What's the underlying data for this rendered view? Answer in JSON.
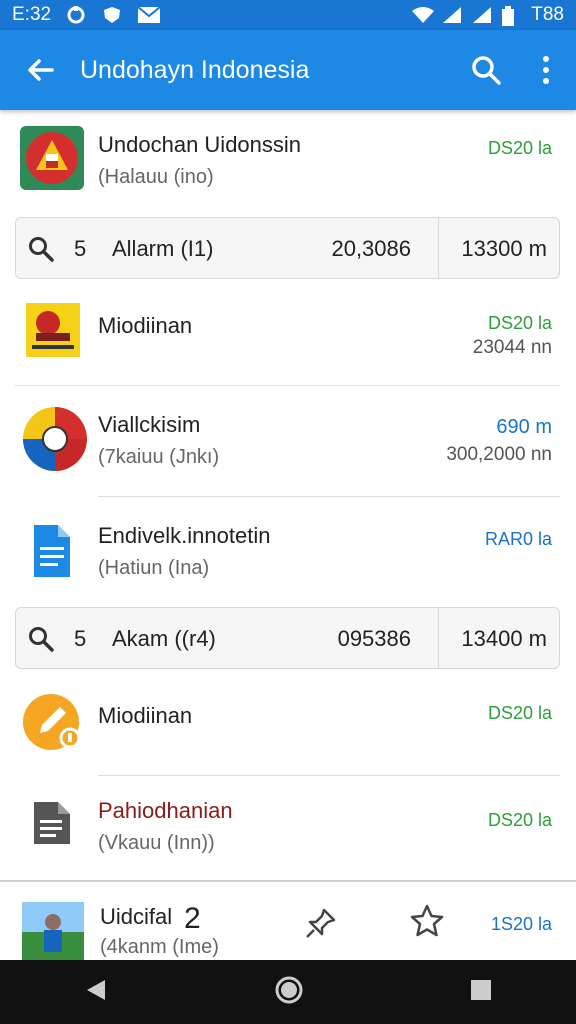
{
  "status": {
    "time": "E:32",
    "right_text": "T88"
  },
  "appbar": {
    "title": "Undohayn Indonesia"
  },
  "items": [
    {
      "title": "Undochan Uidonssin",
      "subtitle": "(Halauu (ino)",
      "right_top": "DS20 la",
      "right_bottom": ""
    },
    {
      "title": "Miodiinan",
      "subtitle": "",
      "right_top": "DS20 la",
      "right_bottom": "23044 nn"
    },
    {
      "title": "Viallckisim",
      "subtitle": "(7kaiuu (Jnkı)",
      "right_top": "690 m",
      "right_bottom": "300,2000 nn"
    },
    {
      "title": "Endivelk.innotetin",
      "subtitle": "(Hatiun (Ina)",
      "right_top": "RAR0 la",
      "right_bottom": ""
    },
    {
      "title": "Miodiinan",
      "subtitle": "",
      "right_top": "DS20 la",
      "right_bottom": ""
    },
    {
      "title": "Pahiodhanian",
      "subtitle": "(Vkauu (Inn))",
      "right_top": "DS20 la",
      "right_bottom": ""
    }
  ],
  "search_rows": [
    {
      "num": "5",
      "label": "Allarm (I1)",
      "value": "20,3086",
      "distance": "13300 m"
    },
    {
      "num": "5",
      "label": "Akam ((r4)",
      "value": "095386",
      "distance": "13400 m"
    }
  ],
  "bottom_item": {
    "title": "Uidcifal",
    "number": "2",
    "subtitle": "(4kanm (Ime)",
    "right_top": "1S20 la"
  },
  "colors": {
    "appbar": "#1e88e5",
    "statusbar": "#1976d2",
    "green": "#2e9e3a",
    "blue": "#1a73c8",
    "red_title": "#8b1a1a"
  }
}
